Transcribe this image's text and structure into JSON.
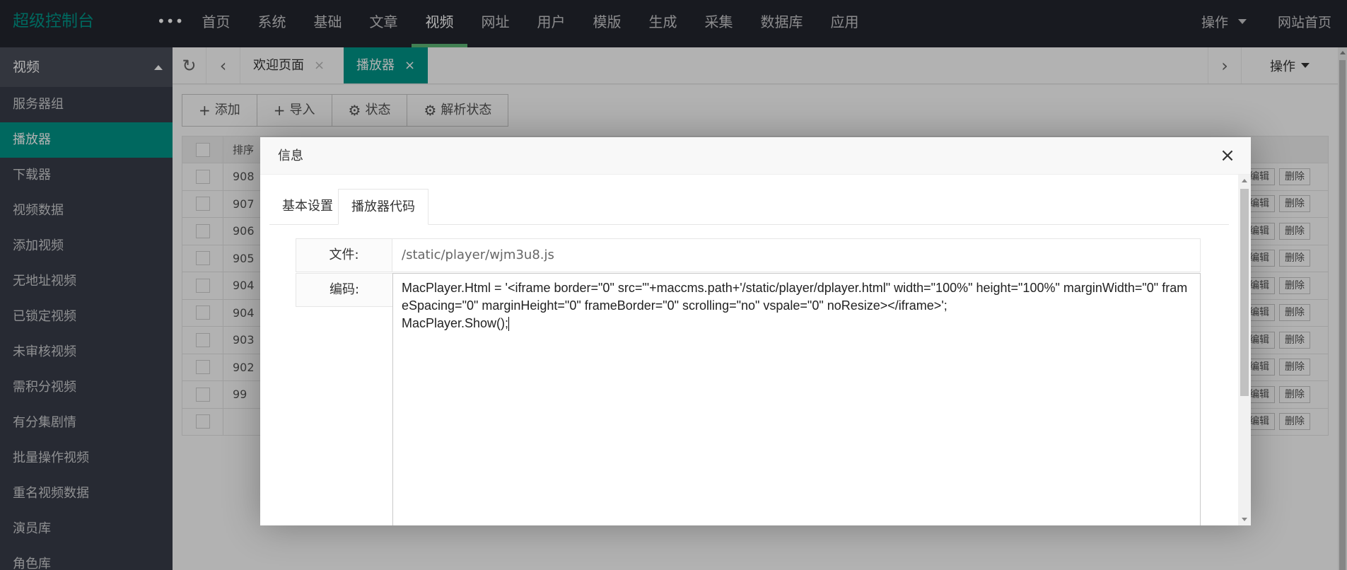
{
  "header": {
    "brand": "超级控制台",
    "more": "•••",
    "nav": [
      "首页",
      "系统",
      "基础",
      "文章",
      "视频",
      "网址",
      "用户",
      "模版",
      "生成",
      "采集",
      "数据库",
      "应用"
    ],
    "active_nav": "视频",
    "ops_label": "操作",
    "site_home": "网站首页"
  },
  "sidebar": {
    "group": "视频",
    "items": [
      "服务器组",
      "播放器",
      "下载器",
      "视频数据",
      "添加视频",
      "无地址视频",
      "已锁定视频",
      "未审核视频",
      "需积分视频",
      "有分集剧情",
      "批量操作视频",
      "重名视频数据",
      "演员库",
      "角色库"
    ],
    "active": "播放器"
  },
  "tabs": {
    "items": [
      {
        "label": "欢迎页面",
        "close": "×"
      },
      {
        "label": "播放器",
        "close": "×"
      }
    ],
    "ops_label": "操作"
  },
  "toolbar": {
    "buttons": [
      {
        "icon": "+",
        "label": "添加"
      },
      {
        "icon": "+",
        "label": "导入"
      },
      {
        "icon": "⚙",
        "label": "状态"
      },
      {
        "icon": "⚙",
        "label": "解析状态"
      }
    ]
  },
  "table": {
    "sort_header": "排序",
    "rows": [
      "908",
      "907",
      "906",
      "905",
      "904",
      "904",
      "903",
      "902",
      "99",
      ""
    ],
    "edit_label": "编辑",
    "delete_label": "删除"
  },
  "modal": {
    "title": "信息",
    "close": "×",
    "tabs": [
      "基本设置",
      "播放器代码"
    ],
    "active_tab": "播放器代码",
    "file_label": "文件:",
    "file_value": "/static/player/wjm3u8.js",
    "code_label": "编码:",
    "code_value": "MacPlayer.Html = '<iframe border=\"0\" src=\"'+maccms.path+'/static/player/dplayer.html\" width=\"100%\" height=\"100%\" marginWidth=\"0\" frameSpacing=\"0\" marginHeight=\"0\" frameBorder=\"0\" scrolling=\"no\" vspale=\"0\" noResize></iframe>';\nMacPlayer.Show();"
  },
  "colors": {
    "accent": "#009688",
    "topbar": "#23262e",
    "sidebar": "#393d49",
    "nav_indicator": "#5fb878"
  }
}
